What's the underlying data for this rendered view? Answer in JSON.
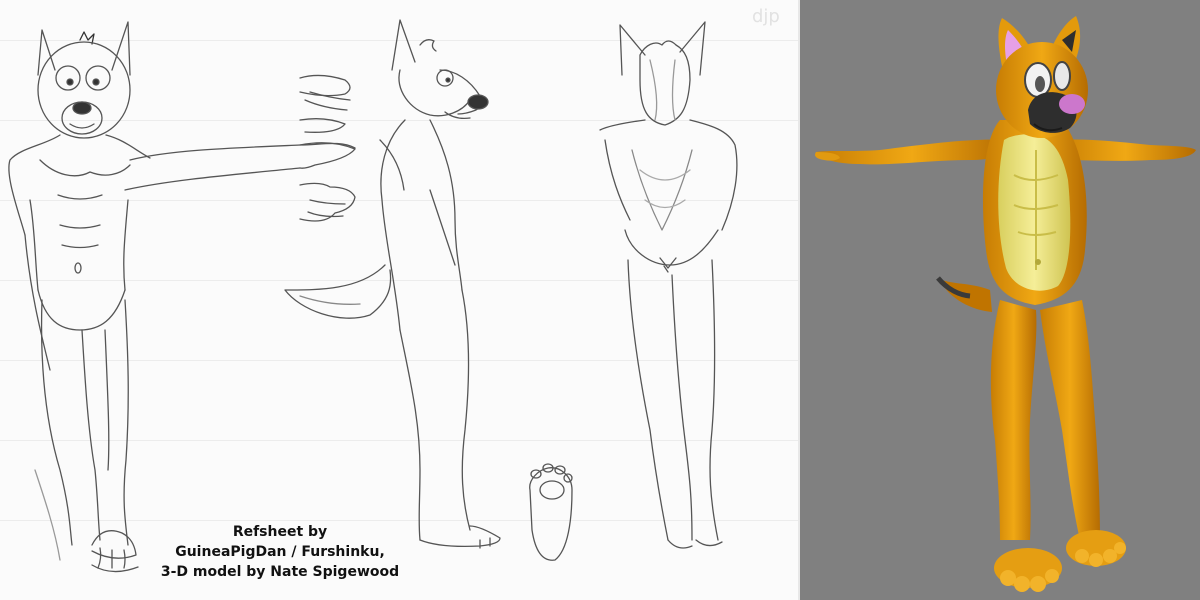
{
  "credits": {
    "line1": "Refsheet by",
    "line2": "GuineaPigDan / Furshinku,",
    "line3": "3-D model by Nate Spigewood"
  },
  "watermark": "djp",
  "colors": {
    "render_background": "#808080",
    "fur_orange": "#e09a0a",
    "fur_dark_orange": "#b86f04",
    "belly_yellow": "#e8e07a",
    "ear_pink": "#e08ee0",
    "nose_pink": "#d07fd0",
    "muzzle_dark": "#2e2e2e"
  }
}
